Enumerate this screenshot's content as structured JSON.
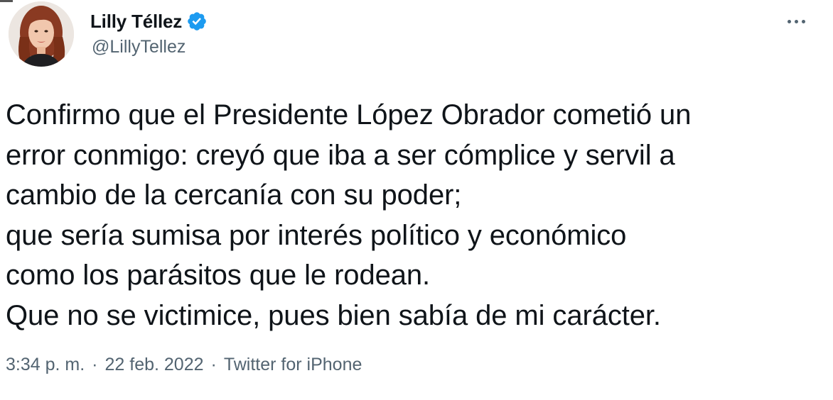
{
  "author": {
    "name": "Lilly Téllez",
    "handle": "@LillyTellez",
    "verified": true,
    "avatar_icon": "profile-photo"
  },
  "tweet": {
    "lines": [
      "Confirmo que el Presidente López Obrador cometió un",
      "error conmigo: creyó que iba a ser cómplice y servil a",
      "cambio de la cercanía con su poder;",
      "que sería sumisa por interés político y económico",
      "como los parásitos que le rodean.",
      "Que no se victimice, pues bien sabía de mi carácter."
    ]
  },
  "meta": {
    "time": "3:34 p. m.",
    "separator": "·",
    "date": "22 feb. 2022",
    "source": "Twitter for iPhone"
  },
  "colors": {
    "text": "#0f1419",
    "secondary": "#536471",
    "verified": "#1d9bf0"
  },
  "icons": {
    "more": "more-horizontal-icon",
    "verified": "verified-badge-icon"
  }
}
